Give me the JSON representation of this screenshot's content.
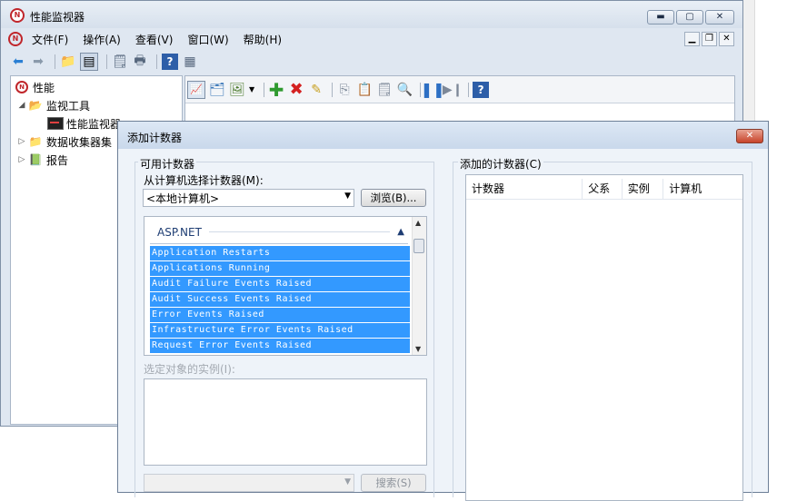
{
  "main_window": {
    "title": "性能监视器",
    "buttons": {
      "minimize": "▬",
      "maximize": "▢",
      "close": "✕"
    },
    "menu": [
      "文件(F)",
      "操作(A)",
      "查看(V)",
      "窗口(W)",
      "帮助(H)"
    ]
  },
  "tree": {
    "root": "性能",
    "monitoring_tools": "监视工具",
    "perf_monitor": "性能监视器",
    "data_collector_sets": "数据收集器集",
    "reports": "报告"
  },
  "dialog": {
    "title": "添加计数器",
    "available_counters_label": "可用计数器",
    "select_from_computer_label": "从计算机选择计数器(M):",
    "computer_value": "<本地计算机>",
    "browse_button": "浏览(B)...",
    "counter_group": "ASP.NET",
    "counters": [
      "Application Restarts",
      "Applications Running",
      "Audit Failure Events Raised",
      "Audit Success Events Raised",
      "Error Events Raised",
      "Infrastructure Error Events Raised",
      "Request Error Events Raised"
    ],
    "instances_label": "选定对象的实例(I):",
    "search_button": "搜索(S)",
    "added_counters_label": "添加的计数器(C)",
    "columns": [
      "计数器",
      "父系",
      "实例",
      "计算机"
    ]
  }
}
